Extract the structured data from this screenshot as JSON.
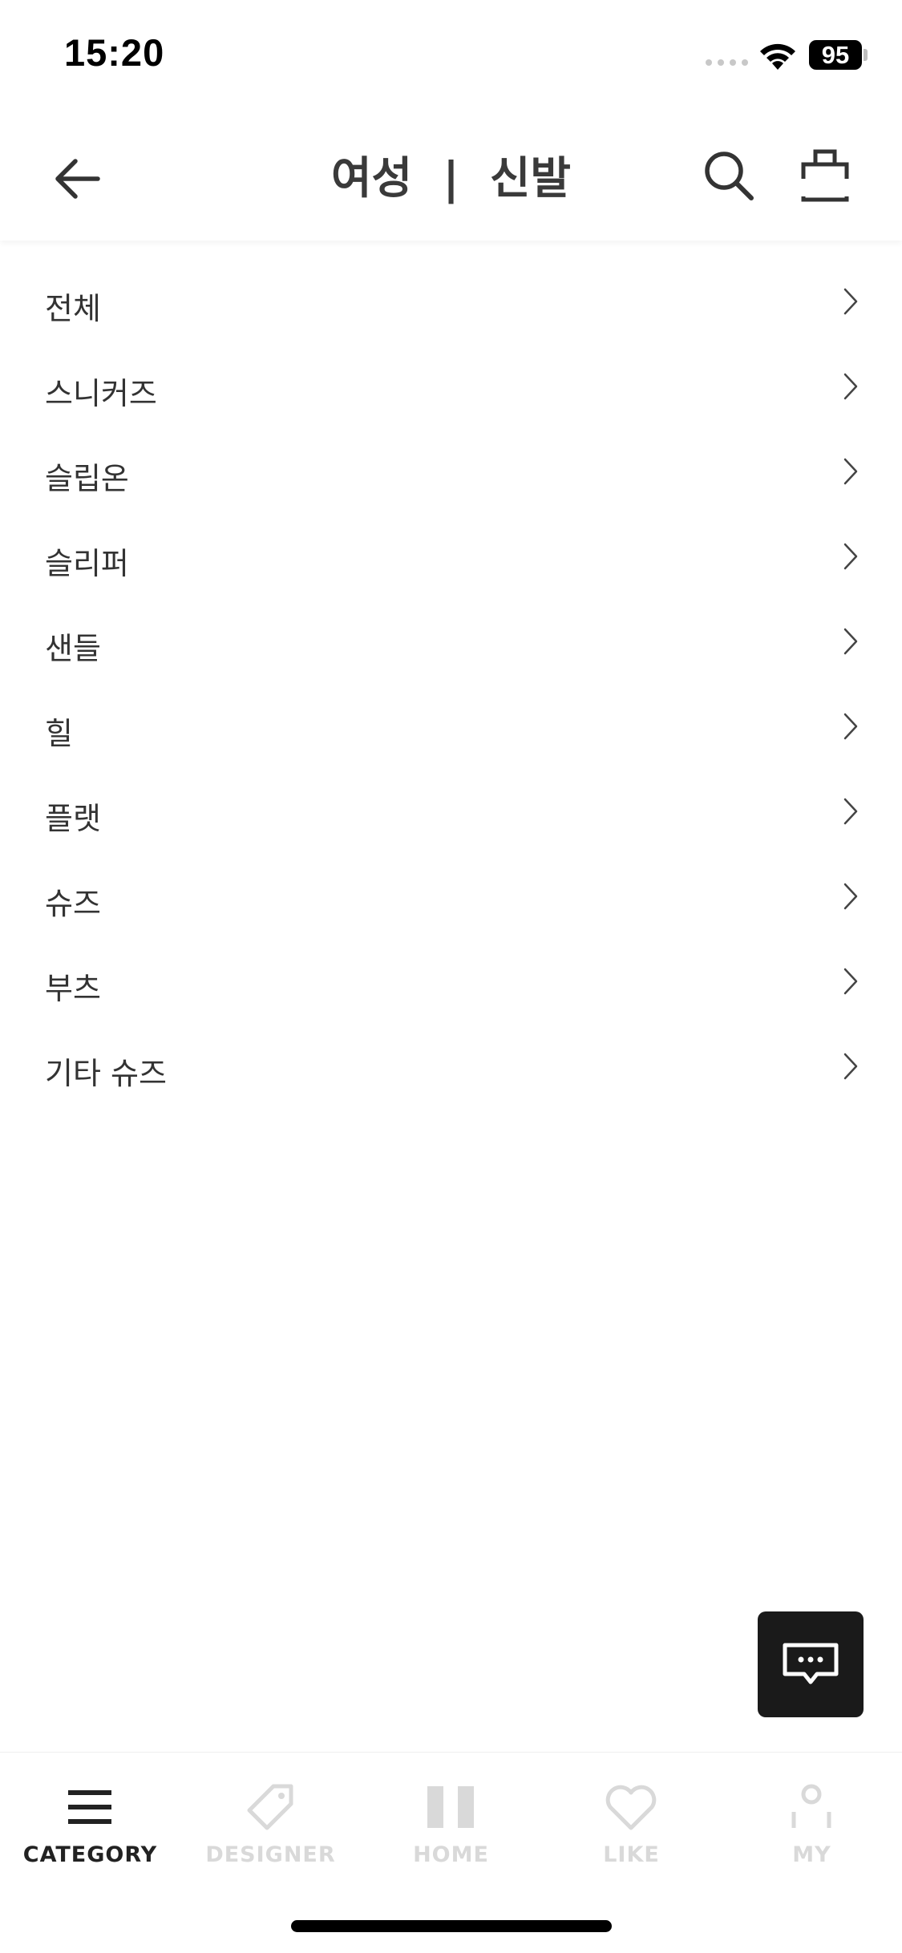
{
  "status_bar": {
    "time": "15:20",
    "battery": "95"
  },
  "header": {
    "title": "여성  |  신발",
    "back_icon": "arrow-left-icon",
    "search_icon": "search-icon",
    "bag_icon": "shopping-bag-icon"
  },
  "categories": [
    {
      "label": "전체"
    },
    {
      "label": "스니커즈"
    },
    {
      "label": "슬립온"
    },
    {
      "label": "슬리퍼"
    },
    {
      "label": "샌들"
    },
    {
      "label": "힐"
    },
    {
      "label": "플랫"
    },
    {
      "label": "슈즈"
    },
    {
      "label": "부츠"
    },
    {
      "label": "기타 슈즈"
    }
  ],
  "chat_button": {
    "icon": "chat-bubble-icon"
  },
  "tab_bar": {
    "tabs": [
      {
        "label": "CATEGORY",
        "icon": "menu-icon",
        "active": true
      },
      {
        "label": "DESIGNER",
        "icon": "tag-icon",
        "active": false
      },
      {
        "label": "HOME",
        "icon": "home-icon",
        "active": false
      },
      {
        "label": "LIKE",
        "icon": "heart-icon",
        "active": false
      },
      {
        "label": "MY",
        "icon": "person-icon",
        "active": false
      }
    ]
  },
  "colors": {
    "text": "#333333",
    "tab_inactive": "#d9d9d9",
    "tab_active": "#222222",
    "fab_background": "#1a1a1a"
  }
}
